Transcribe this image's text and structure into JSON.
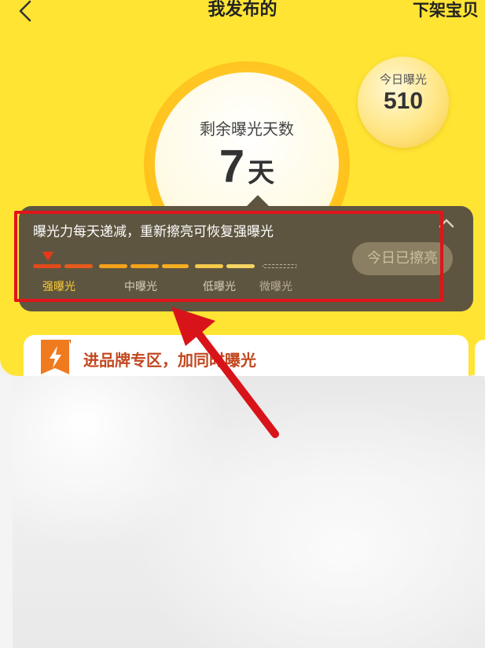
{
  "nav": {
    "title": "我发布的",
    "action": "下架宝贝"
  },
  "exposure": {
    "remaining_label": "剩余曝光天数",
    "remaining_value": "7",
    "remaining_unit": "天"
  },
  "today_badge": {
    "label": "今日曝光",
    "value": "510"
  },
  "tooltip": {
    "message": "曝光力每天递减，重新擦亮可恢复强曝光",
    "levels": [
      {
        "label": "强曝光"
      },
      {
        "label": "中曝光"
      },
      {
        "label": "低曝光"
      },
      {
        "label": "微曝光"
      }
    ],
    "current_level": "强曝光",
    "polish_button": "今日已擦亮"
  },
  "brand": {
    "text": "进品牌专区，加同时曝光"
  },
  "colors": {
    "yellow": "#ffe433",
    "tooltip_bg": "#5e5540",
    "strong": "#e24a1a",
    "medium": "#f4a21a",
    "low": "#f5c94a",
    "annotation": "#e0141a"
  }
}
